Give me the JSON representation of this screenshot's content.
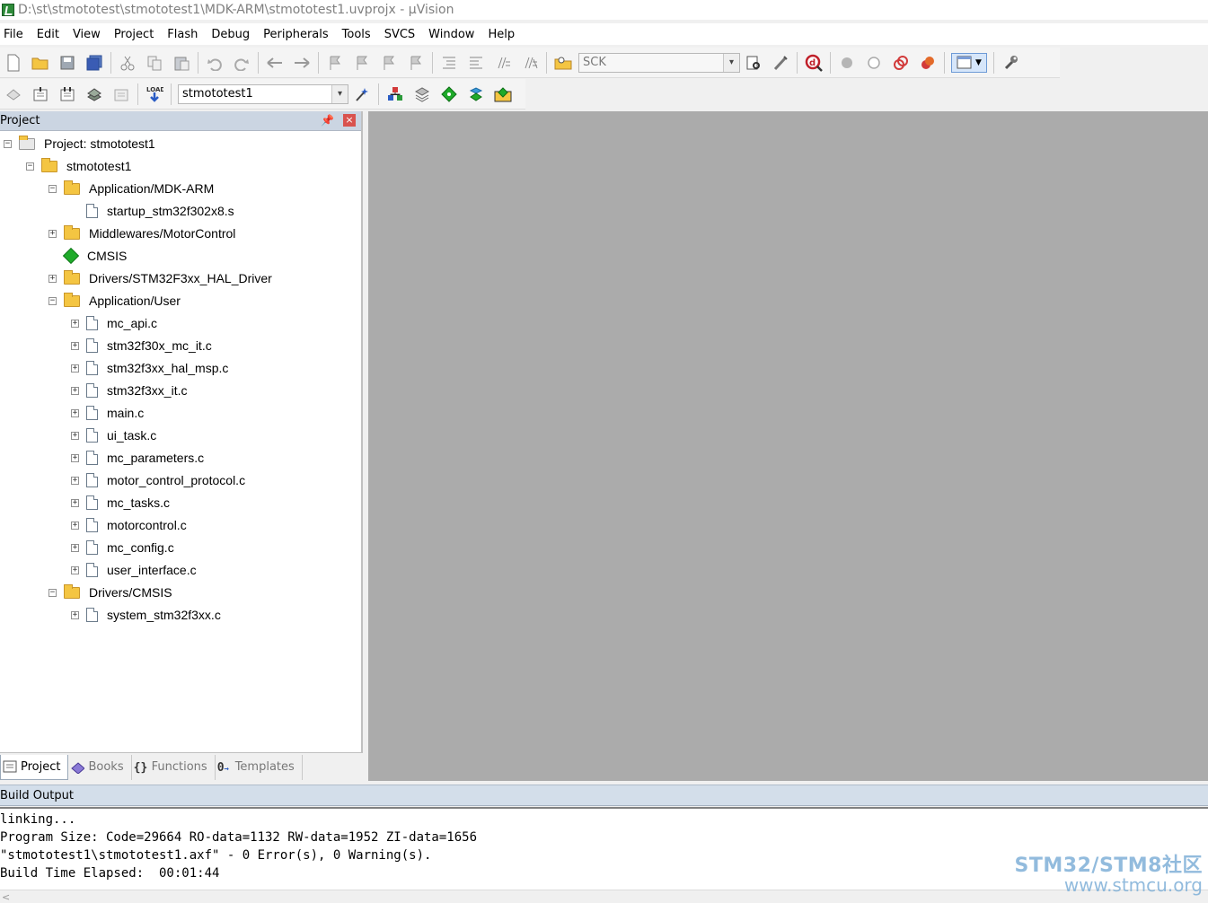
{
  "window": {
    "title": "D:\\st\\stmototest\\stmototest1\\MDK-ARM\\stmototest1.uvprojx - µVision"
  },
  "menu": [
    "File",
    "Edit",
    "View",
    "Project",
    "Flash",
    "Debug",
    "Peripherals",
    "Tools",
    "SVCS",
    "Window",
    "Help"
  ],
  "toolbar": {
    "find_combo": "SCK",
    "target_combo": "stmototest1"
  },
  "project_panel": {
    "title": "Project",
    "tree": [
      {
        "label": "Project: stmototest1",
        "level": 0,
        "kind": "project",
        "expander": "−"
      },
      {
        "label": "stmototest1",
        "level": 1,
        "kind": "target",
        "expander": "−"
      },
      {
        "label": "Application/MDK-ARM",
        "level": 2,
        "kind": "folder-open",
        "expander": "−"
      },
      {
        "label": "startup_stm32f302x8.s",
        "level": 3,
        "kind": "file",
        "expander": ""
      },
      {
        "label": "Middlewares/MotorControl",
        "level": 2,
        "kind": "folder",
        "expander": "+"
      },
      {
        "label": "CMSIS",
        "level": 2,
        "kind": "cmsis",
        "expander": ""
      },
      {
        "label": "Drivers/STM32F3xx_HAL_Driver",
        "level": 2,
        "kind": "folder",
        "expander": "+"
      },
      {
        "label": "Application/User",
        "level": 2,
        "kind": "folder-open",
        "expander": "−"
      },
      {
        "label": "mc_api.c",
        "level": 3,
        "kind": "file",
        "expander": "+"
      },
      {
        "label": "stm32f30x_mc_it.c",
        "level": 3,
        "kind": "file",
        "expander": "+"
      },
      {
        "label": "stm32f3xx_hal_msp.c",
        "level": 3,
        "kind": "file",
        "expander": "+"
      },
      {
        "label": "stm32f3xx_it.c",
        "level": 3,
        "kind": "file",
        "expander": "+"
      },
      {
        "label": "main.c",
        "level": 3,
        "kind": "file",
        "expander": "+"
      },
      {
        "label": "ui_task.c",
        "level": 3,
        "kind": "file",
        "expander": "+"
      },
      {
        "label": "mc_parameters.c",
        "level": 3,
        "kind": "file",
        "expander": "+"
      },
      {
        "label": "motor_control_protocol.c",
        "level": 3,
        "kind": "file",
        "expander": "+"
      },
      {
        "label": "mc_tasks.c",
        "level": 3,
        "kind": "file",
        "expander": "+"
      },
      {
        "label": "motorcontrol.c",
        "level": 3,
        "kind": "file",
        "expander": "+"
      },
      {
        "label": "mc_config.c",
        "level": 3,
        "kind": "file",
        "expander": "+"
      },
      {
        "label": "user_interface.c",
        "level": 3,
        "kind": "file",
        "expander": "+"
      },
      {
        "label": "Drivers/CMSIS",
        "level": 2,
        "kind": "folder-open",
        "expander": "−"
      },
      {
        "label": "system_stm32f3xx.c",
        "level": 3,
        "kind": "file",
        "expander": "+"
      }
    ],
    "tabs": [
      "Project",
      "Books",
      "Functions",
      "Templates"
    ]
  },
  "build_output": {
    "title": "Build Output",
    "lines": [
      "linking...",
      "Program Size: Code=29664 RO-data=1132 RW-data=1952 ZI-data=1656",
      "\"stmototest1\\stmototest1.axf\" - 0 Error(s), 0 Warning(s).",
      "Build Time Elapsed:  00:01:44"
    ]
  },
  "watermark": {
    "line1": "STM32/STM8社区",
    "line2": "www.stmcu.org"
  }
}
